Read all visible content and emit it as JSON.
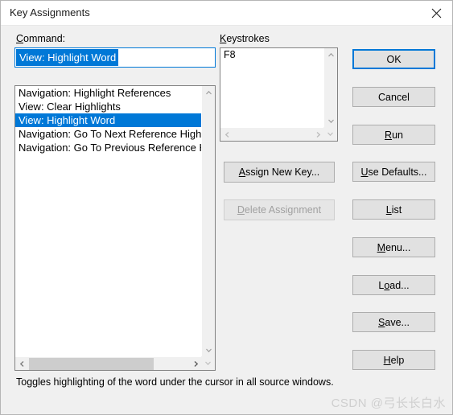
{
  "window": {
    "title": "Key Assignments",
    "close_icon": "close-icon"
  },
  "labels": {
    "command": "Command:",
    "command_accel": "C",
    "keystrokes": "Keystrokes",
    "keystrokes_accel": "K"
  },
  "command_field": {
    "value": "View: Highlight Word",
    "placeholder": ""
  },
  "command_list": {
    "items": [
      {
        "label": "Navigation: Highlight References",
        "selected": false
      },
      {
        "label": "View: Clear Highlights",
        "selected": false
      },
      {
        "label": "View: Highlight Word",
        "selected": true
      },
      {
        "label": "Navigation: Go To Next Reference Highlight",
        "selected": false
      },
      {
        "label": "Navigation: Go To Previous Reference Highlight",
        "selected": false
      }
    ],
    "scroll_up_icon": "chevron-up-icon",
    "scroll_down_icon": "chevron-down-icon",
    "scroll_left_icon": "chevron-left-icon",
    "scroll_right_icon": "chevron-right-icon"
  },
  "keystrokes_list": {
    "items": [
      {
        "label": "F8"
      }
    ],
    "scroll_up_icon": "chevron-up-icon",
    "scroll_down_icon": "chevron-down-icon",
    "scroll_left_icon": "chevron-left-icon",
    "scroll_right_icon": "chevron-right-icon"
  },
  "buttons": {
    "ok": "OK",
    "cancel": "Cancel",
    "run_pre": "",
    "run_accel": "R",
    "run_post": "un",
    "use_defaults_pre": "",
    "use_defaults_accel": "U",
    "use_defaults_post": "se Defaults...",
    "assign_new_key_accel": "A",
    "assign_new_key_post": "ssign New Key...",
    "delete_assignment_accel": "D",
    "delete_assignment_post": "elete Assignment",
    "list_accel": "L",
    "list_post": "ist",
    "menu_accel": "M",
    "menu_post": "enu...",
    "load_pre": "L",
    "load_accel": "o",
    "load_post": "ad...",
    "save_accel": "S",
    "save_post": "ave...",
    "help_accel": "H",
    "help_post": "elp"
  },
  "description": "Toggles highlighting of the word under the cursor in all source windows.",
  "watermark": "CSDN @弓长长白水",
  "colors": {
    "accent": "#0078D7",
    "dialog_bg": "#F0F0F0",
    "button_bg": "#E1E1E1",
    "button_border": "#ADADAD",
    "list_bg": "#FFFFFF",
    "disabled_text": "#A0A0A0"
  }
}
